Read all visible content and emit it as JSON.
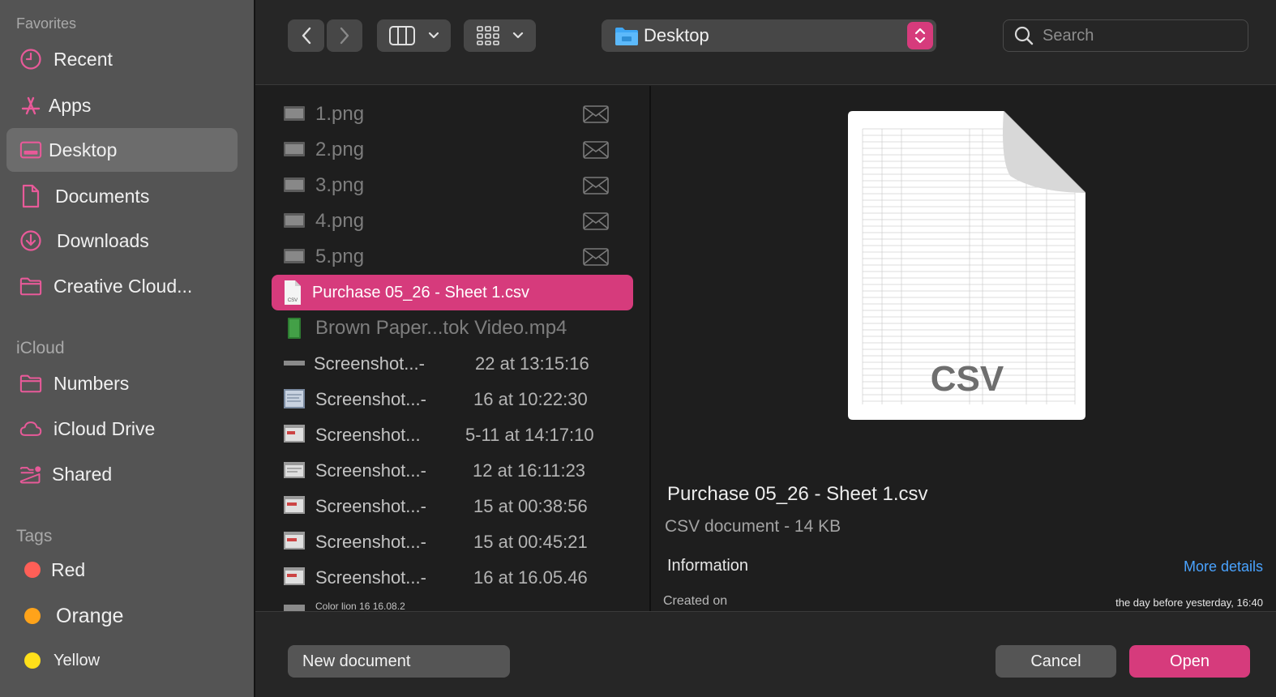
{
  "sidebar": {
    "favorites_header": "Favorites",
    "favorites": [
      {
        "label": "Recent",
        "icon": "clock-icon"
      },
      {
        "label": "Apps",
        "icon": "apps-icon"
      },
      {
        "label": "Desktop",
        "icon": "desktop-icon",
        "selected": true
      },
      {
        "label": "Documents",
        "icon": "document-icon"
      },
      {
        "label": "Downloads",
        "icon": "download-icon"
      },
      {
        "label": "Creative Cloud...",
        "icon": "folder-icon"
      }
    ],
    "icloud_header": "iCloud",
    "icloud": [
      {
        "label": "Numbers",
        "icon": "folder-icon"
      },
      {
        "label": "iCloud Drive",
        "icon": "cloud-icon"
      },
      {
        "label": "Shared",
        "icon": "shared-folder-icon"
      }
    ],
    "tags_header": "Tags",
    "tags": [
      {
        "label": "Red",
        "color": "#ff5f57"
      },
      {
        "label": "Orange",
        "color": "#ffa31a"
      },
      {
        "label": "Yellow",
        "color": "#ffe01a"
      }
    ]
  },
  "toolbar": {
    "location": "Desktop",
    "search_placeholder": "Search",
    "accent": "#d63b7c"
  },
  "files": [
    {
      "name": "1.png",
      "meta": "",
      "dim": true
    },
    {
      "name": "2.png",
      "meta": "",
      "dim": true
    },
    {
      "name": "3.png",
      "meta": "",
      "dim": true
    },
    {
      "name": "4.png",
      "meta": "",
      "dim": true
    },
    {
      "name": "5.png",
      "meta": "",
      "dim": true
    },
    {
      "name": "Purchase 05_26 - Sheet 1.csv",
      "meta": "",
      "selected": true
    },
    {
      "name": "Brown Paper...tok Video.mp4",
      "meta": "",
      "dim": true
    },
    {
      "name": "Screenshot...-",
      "meta": "22 at 13:15:16"
    },
    {
      "name": "Screenshot...-",
      "meta": "16 at 10:22:30"
    },
    {
      "name": "Screenshot...",
      "meta": "5-11 at 14:17:10"
    },
    {
      "name": "Screenshot...-",
      "meta": "12 at 16:11:23"
    },
    {
      "name": "Screenshot...-",
      "meta": "15 at 00:38:56"
    },
    {
      "name": "Screenshot...-",
      "meta": "15 at 00:45:21"
    },
    {
      "name": "Screenshot...-",
      "meta": "16 at 16.05.46"
    },
    {
      "name": "Color lion 16 16.08.2",
      "meta": ""
    }
  ],
  "preview": {
    "thumb_label": "CSV",
    "file_name": "Purchase 05_26 - Sheet 1.csv",
    "kind": "CSV document - 14 KB",
    "info_header": "Information",
    "more_details": "More details",
    "created_label": "Created on",
    "created_value": "the day before yesterday, 16:40"
  },
  "buttons": {
    "new_document": "New document",
    "cancel": "Cancel",
    "open": "Open"
  }
}
